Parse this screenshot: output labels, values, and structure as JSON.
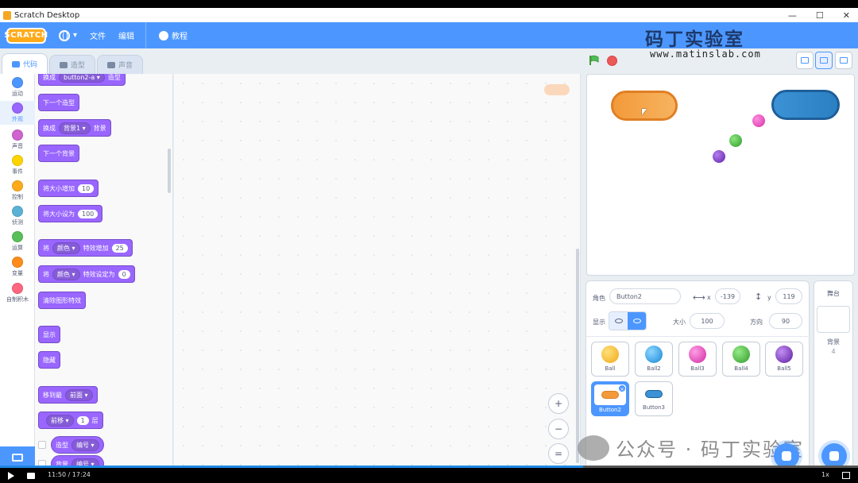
{
  "window": {
    "title": "Scratch Desktop",
    "minimize": "—",
    "maximize": "☐",
    "close": "✕"
  },
  "menubar": {
    "logo": "SCRATCH",
    "language_arrow": "▾",
    "file": "文件",
    "edit": "编辑",
    "tutorials": "教程"
  },
  "watermark": {
    "brand": "码丁实验室",
    "url": "www.matinslab.com",
    "wechat": "公众号 · 码丁实验室"
  },
  "tabs": [
    {
      "label": "代码",
      "active": true
    },
    {
      "label": "造型",
      "active": false
    },
    {
      "label": "声音",
      "active": false
    }
  ],
  "categories": [
    {
      "label": "运动",
      "color": "#4c97ff"
    },
    {
      "label": "外观",
      "color": "#9966ff",
      "active": true
    },
    {
      "label": "声音",
      "color": "#cf63cf"
    },
    {
      "label": "事件",
      "color": "#ffd500"
    },
    {
      "label": "控制",
      "color": "#ffab19"
    },
    {
      "label": "侦测",
      "color": "#5cb1d6"
    },
    {
      "label": "运算",
      "color": "#59c059"
    },
    {
      "label": "变量",
      "color": "#ff8c1a"
    },
    {
      "label": "自制积木",
      "color": "#ff6680"
    }
  ],
  "blocks": {
    "switch_costume": {
      "pre": "换成",
      "dropdown": "button2-a ▾",
      "post": "造型"
    },
    "next_costume": "下一个造型",
    "switch_backdrop": {
      "pre": "换成",
      "dropdown": "背景1 ▾",
      "post": "背景"
    },
    "next_backdrop": "下一个背景",
    "change_size": {
      "pre": "将大小增加",
      "value": "10"
    },
    "set_size": {
      "pre": "将大小设为",
      "value": "100"
    },
    "change_effect": {
      "pre": "将",
      "dropdown": "颜色 ▾",
      "mid": "特效增加",
      "value": "25"
    },
    "set_effect": {
      "pre": "将",
      "dropdown": "颜色 ▾",
      "mid": "特效设定为",
      "value": "0"
    },
    "clear_effects": "清除图形特效",
    "show": "显示",
    "hide": "隐藏",
    "go_to_layer": {
      "pre": "移到最",
      "dropdown": "前面 ▾"
    },
    "go_layers": {
      "pre": "",
      "dropdown": "前移 ▾",
      "value": "1",
      "post": "层"
    },
    "costume_reporter": {
      "pre": "造型",
      "dropdown": "编号 ▾"
    },
    "backdrop_reporter": {
      "pre": "背景",
      "dropdown": "编号 ▾"
    }
  },
  "zoom": {
    "in": "+",
    "out": "−",
    "reset": "="
  },
  "sprite_info": {
    "sprite_label": "角色",
    "sprite_name": "Button2",
    "x_label": "x",
    "x": "-139",
    "y_label": "y",
    "y": "119",
    "show_label": "显示",
    "size_label": "大小",
    "size": "100",
    "direction_label": "方向",
    "direction": "90"
  },
  "sprites": [
    {
      "name": "Ball",
      "color": "#f5b82e"
    },
    {
      "name": "Ball2",
      "color": "#2aa5ef"
    },
    {
      "name": "Ball3",
      "color": "#e33fb3"
    },
    {
      "name": "Ball4",
      "color": "#3fb93a"
    },
    {
      "name": "Ball5",
      "color": "#7b2fc2"
    },
    {
      "name": "Button2",
      "color": "#f39a3a",
      "selected": true
    },
    {
      "name": "Button3",
      "color": "#3b92d4"
    }
  ],
  "backdrop": {
    "label": "舞台",
    "count_label": "背景",
    "count": "4"
  },
  "player": {
    "time": "11:50 / 17:24",
    "speed": "1x",
    "progress": 0.68
  },
  "colors": {
    "accent": "#4c97ff",
    "looks": "#9966ff"
  }
}
